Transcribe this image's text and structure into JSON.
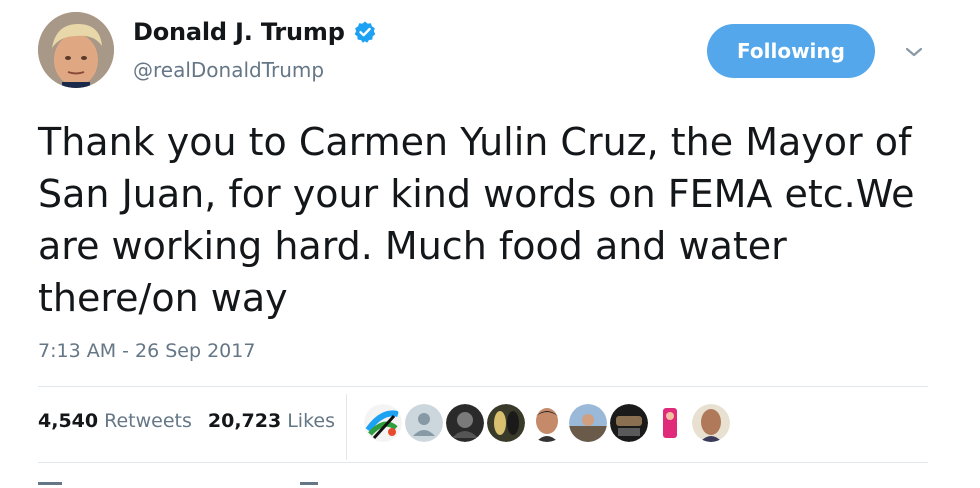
{
  "tweet": {
    "author": {
      "display_name": "Donald J. Trump",
      "handle": "@realDonaldTrump",
      "verified_icon": "verified-badge-icon",
      "avatar_icon": "profile-avatar"
    },
    "follow_button_label": "Following",
    "menu_icon": "chevron-down-icon",
    "text": "Thank you to Carmen Yulin Cruz, the Mayor of San Juan, for your kind words on FEMA etc.We are working hard. Much food and water there/on way",
    "timestamp": "7:13 AM - 26 Sep 2017",
    "stats": {
      "retweets_count": "4,540",
      "retweets_label": "Retweets",
      "likes_count": "20,723",
      "likes_label": "Likes"
    },
    "likers": [
      {
        "icon": "liker-avatar"
      },
      {
        "icon": "default-avatar-icon"
      },
      {
        "icon": "liker-avatar"
      },
      {
        "icon": "liker-avatar"
      },
      {
        "icon": "liker-avatar"
      },
      {
        "icon": "liker-avatar"
      },
      {
        "icon": "liker-avatar"
      },
      {
        "icon": "liker-avatar"
      },
      {
        "icon": "liker-avatar"
      }
    ]
  },
  "colors": {
    "accent": "#1da1f2",
    "follow_button": "#53a7ea",
    "secondary_text": "#657786",
    "divider": "#e1e8ed"
  }
}
